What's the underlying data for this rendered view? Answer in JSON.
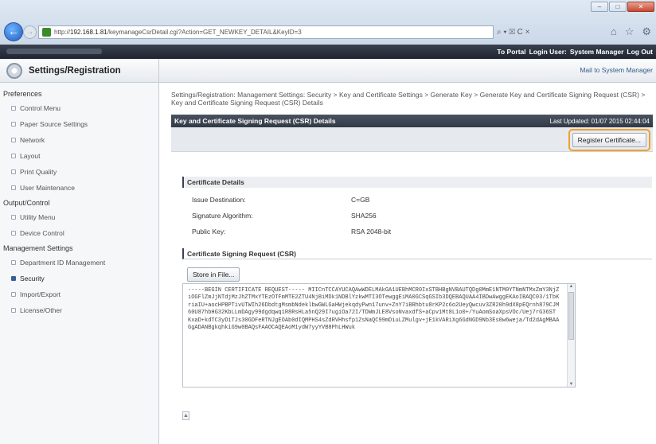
{
  "browser": {
    "url_prefix": "http://",
    "url_host": "192.168.1.81",
    "url_path": "/keymanageCsrDetail.cgi?Action=GET_NEWKEY_DETAIL&KeyID=3",
    "search_label": "⌕ ▾ ☒ C ×",
    "window_buttons": [
      "–",
      "□",
      "✕"
    ],
    "tool_icons": [
      "⌂",
      "☆",
      "⚙"
    ]
  },
  "topbar": {
    "portal": "To Portal",
    "login_user_label": "Login User:",
    "login_user": "System Manager",
    "logout": "Log Out"
  },
  "app": {
    "title": "Settings/Registration",
    "mail_link": "Mail to System Manager"
  },
  "sidebar": {
    "preferences_label": "Preferences",
    "preferences": [
      "Control Menu",
      "Paper Source Settings",
      "Network",
      "Layout",
      "Print Quality",
      "User Maintenance"
    ],
    "output_label": "Output/Control",
    "output": [
      "Utility Menu",
      "Device Control"
    ],
    "management_label": "Management Settings",
    "management": [
      "Department ID Management",
      "Security",
      "Import/Export",
      "License/Other"
    ]
  },
  "main": {
    "breadcrumb": "Settings/Registration: Management Settings: Security > Key and Certificate Settings > Generate Key > Generate Key and Certificate Signing Request (CSR) > Key and Certificate Signing Request (CSR) Details",
    "section_title": "Key and Certificate Signing Request (CSR) Details",
    "last_updated": "Last Updated: 01/07 2015 02:44:04",
    "register_button": "Register Certificate...",
    "cert_details_title": "Certificate Details",
    "issue_destination_label": "Issue Destination:",
    "issue_destination": "C=GB",
    "signature_algorithm_label": "Signature Algorithm:",
    "signature_algorithm": "SHA256",
    "public_key_label": "Public Key:",
    "public_key": "RSA 2048-bit",
    "csr_title": "Certificate Signing Request (CSR)",
    "store_button": "Store in File...",
    "csr_text": "-----BEGIN CERTIFICATE REQUEST----- MIICnTCCAYUCAQAwWDELMAkGA1UEBhMCR0IxSTBHBgNVBAUTQDg0MmE1NTM0YTNmNTMxZmY3NjZiOGFlZmJjNTdjMzJhZTMxYTEzOTFmMTE2ZTU4NjBiMDk1NDBlYzkwMTI3OTewggEiMA0GCSqGSIb3DQEBAQUAA4IBDwAwggEKAoIBAQC03/1TbKriaIU+aocHPBPTivUTWIh26DbdtgMsmbNdeklbwGWLGaHWjekqdyPwn17unv+ZnY7iBRhbtu8rKP2c6o2UeyQwcuv3ZR20h9dX8pEQrnh879CJM60U87hbHG32KbLLmDAgy99dgdqwq1R8RsHLa5nQ29I7ugiOa72I/TDWmJLE8VsoNvaxdfS+aCpv1Mt8L1o0+/YuAomSoaXpsVOc/Uej7rG36ST KxaD+kdTC3yDiTJs30GDFeRTNJgEOAb0dIQMPHS4sZdRVHhsfp1ZsNaQC99mDiuLZMulgv+jE1kVARiXg6GdNGD9Nb3Es0w6weja/Td2dAgMBAAGgADANBgkqhkiG9w0BAQsFAAOCAQEAoM1ydW7yyYVB8PhLHWuk"
  }
}
